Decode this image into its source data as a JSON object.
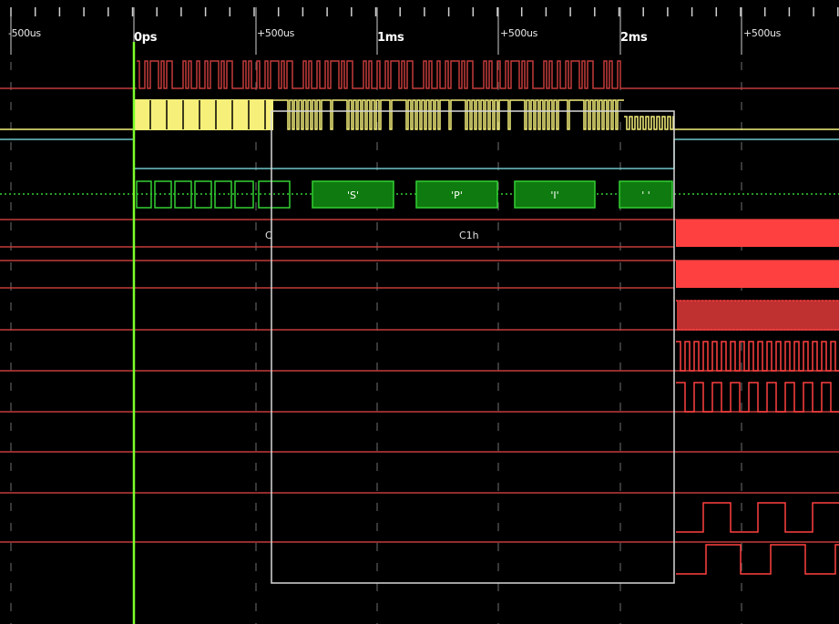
{
  "ruler": {
    "labels": [
      "-500us",
      "0ps",
      "+500us",
      "1ms",
      "+500us",
      "2ms",
      "+500us"
    ],
    "major": [
      false,
      true,
      false,
      true,
      false,
      true,
      false
    ]
  },
  "decode": {
    "bytes": [
      "'S'",
      "'P'",
      "'I'",
      "' '"
    ],
    "annotation": "C1h",
    "annotation_prefix": "C"
  },
  "colors": {
    "background": "#000000",
    "trace": "#c43b3b",
    "trace_bright": "#ff4040",
    "clock": "#f5f07a",
    "cyan": "#6ec6c8",
    "decode_fill": "#0f7a0f",
    "decode_border": "#33d033",
    "cursor": "#7cff2a",
    "selection": "#d8d8d8",
    "grid": "#707070"
  }
}
